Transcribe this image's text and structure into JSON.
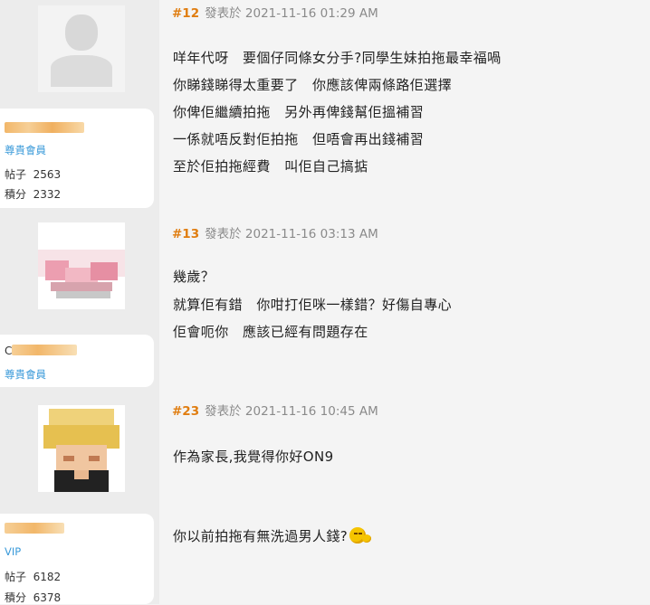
{
  "posts": [
    {
      "floor": "#12",
      "posted_label": "發表於 2021-11-16 01:29 AM",
      "user": {
        "rank": "尊貴會員",
        "posts_label": "帖子",
        "posts": "2563",
        "credits_label": "積分",
        "credits": "2332"
      },
      "lines": [
        "咩年代呀　要個仔同條女分手?同學生妹拍拖最幸福喎",
        "你睇錢睇得太重要了　你應該俾兩條路佢選擇",
        "你俾佢繼續拍拖　另外再俾錢幫佢搵補習",
        "一係就唔反對佢拍拖　但唔會再出錢補習",
        "至於佢拍拖經費　叫佢自己搞掂"
      ]
    },
    {
      "floor": "#13",
      "posted_label": "發表於 2021-11-16 03:13 AM",
      "user": {
        "rank": "尊貴會員",
        "name_initial": "C"
      },
      "lines": [
        "幾歲？",
        "就算佢有錯　你咁打佢咪一樣錯？好傷自專心",
        "佢會呃你　應該已經有問題存在"
      ]
    },
    {
      "floor": "#23",
      "posted_label": "發表於 2021-11-16 10:45 AM",
      "user": {
        "rank": "VIP",
        "posts_label": "帖子",
        "posts": "6182",
        "credits_label": "積分",
        "credits": "6378"
      },
      "lines": [
        "作為家長,我覺得你好ON9",
        "你以前拍拖有無洗過男人錢?"
      ],
      "emoji": "sweat-smile-emoji-icon"
    }
  ],
  "colors": {
    "floor": "#e07d10",
    "rank": "#3a9ad9",
    "meta": "#8a8a8a"
  }
}
